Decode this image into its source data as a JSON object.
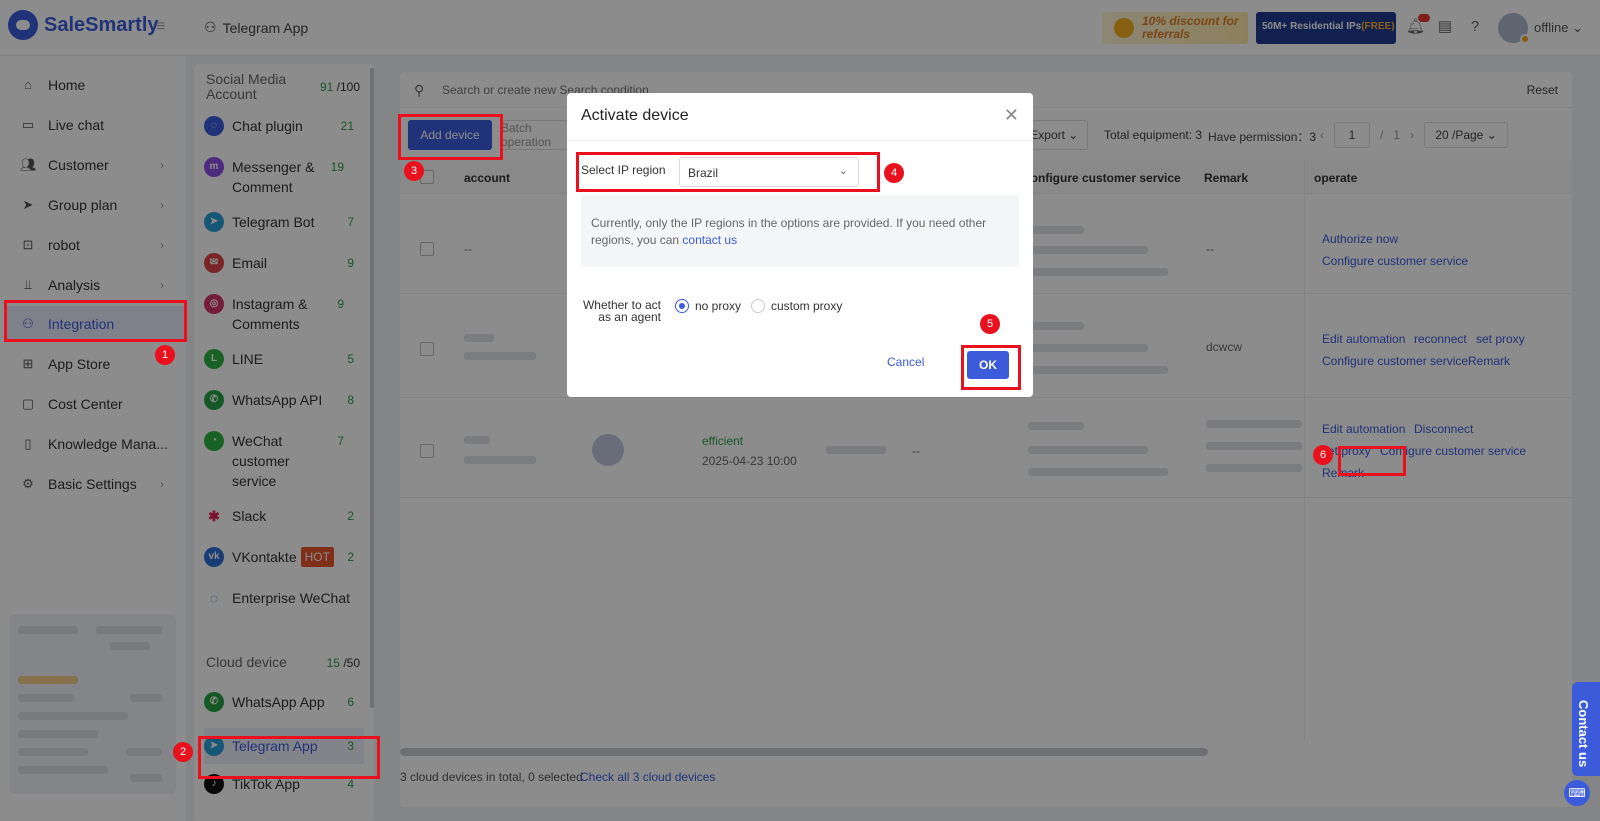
{
  "app": {
    "logo_text": "SaleSmartly",
    "page_title": "Telegram App"
  },
  "topbar": {
    "promo_discount": "10% discount for referrals",
    "promo_ips_prefix": "50M+ Residential IPs",
    "promo_ips_free": "(FREE)",
    "status": "offline"
  },
  "nav": {
    "items": [
      {
        "label": "Home"
      },
      {
        "label": "Live chat"
      },
      {
        "label": "Customer"
      },
      {
        "label": "Group plan"
      },
      {
        "label": "robot"
      },
      {
        "label": "Analysis"
      },
      {
        "label": "Integration"
      },
      {
        "label": "App Store"
      },
      {
        "label": "Cost Center"
      },
      {
        "label": "Knowledge Mana..."
      },
      {
        "label": "Basic Settings"
      }
    ]
  },
  "channels": {
    "social_title": "Social Media Account",
    "social_used": "91",
    "social_total": " /100",
    "social_items": [
      {
        "label": "Chat plugin",
        "count": "21"
      },
      {
        "label": "Messenger & Comment",
        "count": "19"
      },
      {
        "label": "Telegram Bot",
        "count": "7"
      },
      {
        "label": "Email",
        "count": "9"
      },
      {
        "label": "Instagram & Comments",
        "count": "9"
      },
      {
        "label": "LINE",
        "count": "5"
      },
      {
        "label": "WhatsApp API",
        "count": "8"
      },
      {
        "label": "WeChat customer service",
        "count": "7"
      },
      {
        "label": "Slack",
        "count": "2"
      },
      {
        "label": "VKontakte",
        "count": "2",
        "tag": "HOT"
      },
      {
        "label": "Enterprise WeChat",
        "count": ""
      }
    ],
    "cloud_title": "Cloud device",
    "cloud_used": "15",
    "cloud_total": " /50",
    "cloud_items": [
      {
        "label": "WhatsApp App",
        "count": "6"
      },
      {
        "label": "Telegram App",
        "count": "3"
      },
      {
        "label": "TikTok App",
        "count": "4"
      }
    ]
  },
  "content": {
    "search_placeholder": "Search or create new Search condition",
    "reset": "Reset",
    "add_device": "Add device",
    "batch_op": "Batch operation",
    "export": "Export",
    "total_equipment": "Total equipment: 3",
    "have_permission": "Have permission：3",
    "page_current": "1",
    "page_sep": "/",
    "page_total": "1",
    "page_size": "20 /Page",
    "columns": {
      "account": "account",
      "configure": "Configure customer service",
      "remark": "Remark",
      "operate": "operate"
    },
    "rows": [
      {
        "account": "--",
        "remark": "--",
        "ops": [
          "Authorize now",
          "Configure customer service"
        ]
      },
      {
        "remark": "dcwcw",
        "ops": [
          "Edit automation",
          "reconnect",
          "set proxy",
          "Configure customer service",
          "Remark"
        ]
      },
      {
        "status": "efficient",
        "time": "2025-04-23 10:00",
        "dash": "--",
        "ops": [
          "Edit automation",
          "Disconnect",
          "set proxy",
          "Configure customer service",
          "Remark"
        ]
      }
    ],
    "footer_count": "3 cloud devices in total, 0 selected",
    "footer_link": "Check all 3 cloud devices"
  },
  "modal": {
    "title": "Activate device",
    "ip_label": "Select IP region",
    "ip_value": "Brazil",
    "notice": "Currently, only the IP regions in the options are provided. If you need other regions, you can ",
    "notice_link": "contact us",
    "agent_label": "Whether to act as an agent",
    "radio_no_proxy": "no proxy",
    "radio_custom": "custom proxy",
    "cancel": "Cancel",
    "ok": "OK"
  },
  "annotations": [
    "1",
    "2",
    "3",
    "4",
    "5",
    "6"
  ],
  "contact_tab": "Contact us",
  "colors": {
    "accent": "#3b5bdb",
    "highlight": "#e8111d",
    "success": "#2e9d4b"
  }
}
